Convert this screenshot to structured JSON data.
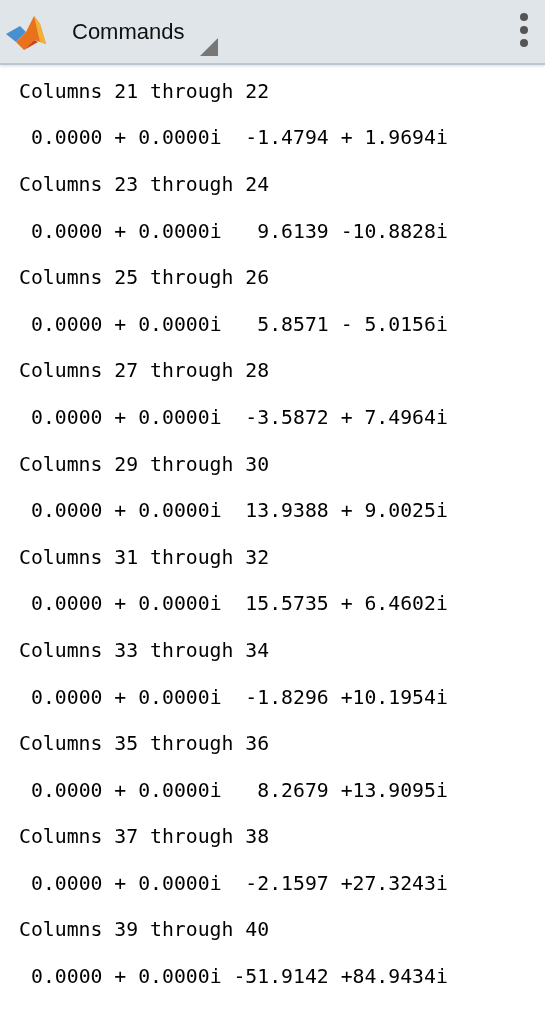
{
  "toolbar": {
    "title": "Commands"
  },
  "output": [
    {
      "kind": "heading",
      "text": "Columns 21 through 22"
    },
    {
      "kind": "values",
      "text": "0.0000 + 0.0000i  -1.4794 + 1.9694i"
    },
    {
      "kind": "heading",
      "text": "Columns 23 through 24"
    },
    {
      "kind": "values",
      "text": "0.0000 + 0.0000i   9.6139 -10.8828i"
    },
    {
      "kind": "heading",
      "text": "Columns 25 through 26"
    },
    {
      "kind": "values",
      "text": "0.0000 + 0.0000i   5.8571 - 5.0156i"
    },
    {
      "kind": "heading",
      "text": "Columns 27 through 28"
    },
    {
      "kind": "values",
      "text": "0.0000 + 0.0000i  -3.5872 + 7.4964i"
    },
    {
      "kind": "heading",
      "text": "Columns 29 through 30"
    },
    {
      "kind": "values",
      "text": "0.0000 + 0.0000i  13.9388 + 9.0025i"
    },
    {
      "kind": "heading",
      "text": "Columns 31 through 32"
    },
    {
      "kind": "values",
      "text": "0.0000 + 0.0000i  15.5735 + 6.4602i"
    },
    {
      "kind": "heading",
      "text": "Columns 33 through 34"
    },
    {
      "kind": "values",
      "text": "0.0000 + 0.0000i  -1.8296 +10.1954i"
    },
    {
      "kind": "heading",
      "text": "Columns 35 through 36"
    },
    {
      "kind": "values",
      "text": "0.0000 + 0.0000i   8.2679 +13.9095i"
    },
    {
      "kind": "heading",
      "text": "Columns 37 through 38"
    },
    {
      "kind": "values",
      "text": "0.0000 + 0.0000i  -2.1597 +27.3243i"
    },
    {
      "kind": "heading",
      "text": "Columns 39 through 40"
    },
    {
      "kind": "values",
      "text": "0.0000 + 0.0000i -51.9142 +84.9434i"
    }
  ]
}
